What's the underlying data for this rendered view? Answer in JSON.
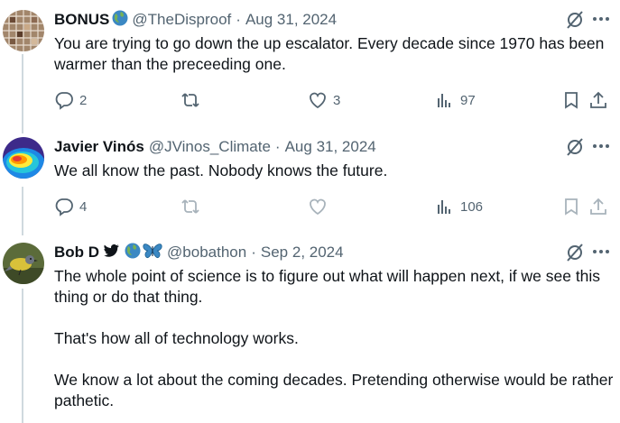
{
  "tweets": [
    {
      "name": "BONUS",
      "handle": "@TheDisproof",
      "separator": "·",
      "date": "Aug 31, 2024",
      "text": [
        "You are trying to go down the up escalator.  Every decade since 1970 has been warmer than the preceeding one."
      ],
      "replies": "2",
      "reposts": "",
      "likes": "3",
      "views": "97",
      "icons": [
        "globe-emoji"
      ]
    },
    {
      "name": "Javier Vinós",
      "handle": "@JVinos_Climate",
      "separator": "·",
      "date": "Aug 31, 2024",
      "text": [
        "We all know the past. Nobody knows the future."
      ],
      "replies": "4",
      "reposts": "",
      "likes": "",
      "views": "106"
    },
    {
      "name": "Bob D",
      "handle": "@bobathon",
      "separator": "·",
      "date": "Sep 2, 2024",
      "text": [
        "The whole point of science is to figure out what will happen next, if we see this thing or do that thing.",
        "That's how all of technology works.",
        "We know a lot about the coming decades. Pretending otherwise would be rather pathetic."
      ],
      "icons": [
        "bird-icon",
        "globe-emoji",
        "butterfly-emoji"
      ]
    }
  ],
  "colors": {
    "text": "#0f1419",
    "muted": "#536471",
    "line": "#cfd9de",
    "disabled": "#a8b3bb"
  }
}
